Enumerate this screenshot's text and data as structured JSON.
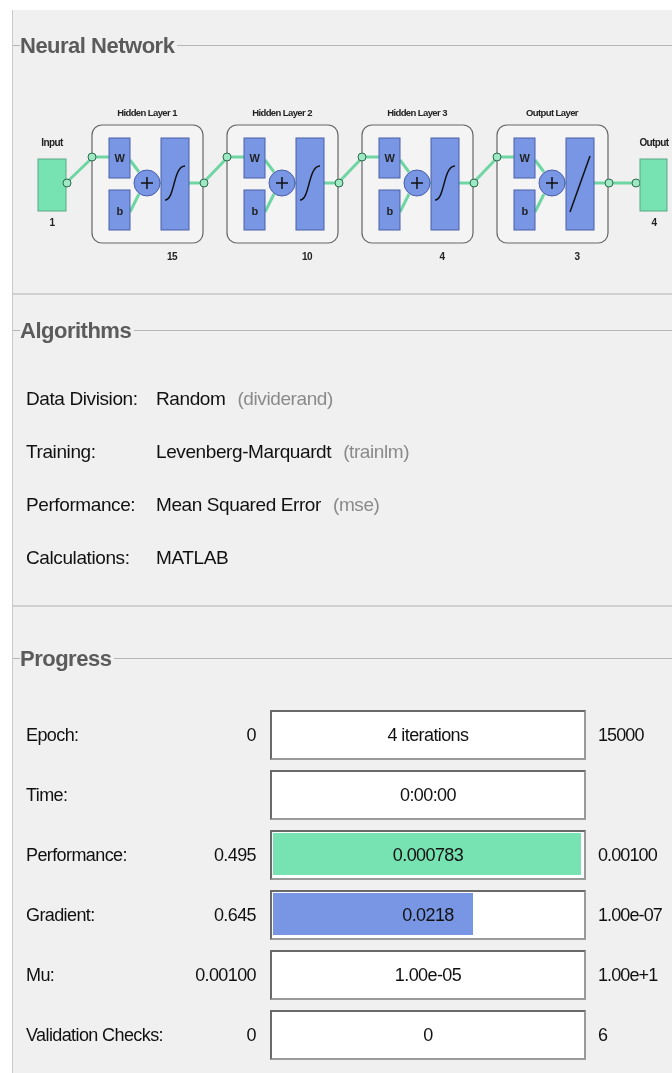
{
  "neural_network": {
    "title": "Neural Network",
    "input": {
      "label": "Input",
      "size": "1"
    },
    "layers": [
      {
        "title": "Hidden Layer 1",
        "size": "15",
        "weight_label": "W",
        "bias_label": "b",
        "kind": "sigmoid"
      },
      {
        "title": "Hidden Layer 2",
        "size": "10",
        "weight_label": "W",
        "bias_label": "b",
        "kind": "sigmoid"
      },
      {
        "title": "Hidden Layer 3",
        "size": "4",
        "weight_label": "W",
        "bias_label": "b",
        "kind": "sigmoid"
      },
      {
        "title": "Output Layer",
        "size": "3",
        "weight_label": "W",
        "bias_label": "b",
        "kind": "linear"
      }
    ],
    "output": {
      "label": "Output",
      "size": "4"
    }
  },
  "algorithms": {
    "title": "Algorithms",
    "rows": [
      {
        "label": "Data Division:",
        "value": "Random",
        "function": "(dividerand)"
      },
      {
        "label": "Training:",
        "value": "Levenberg-Marquardt",
        "function": "(trainlm)"
      },
      {
        "label": "Performance:",
        "value": "Mean Squared Error",
        "function": "(mse)"
      },
      {
        "label": "Calculations:",
        "value": "MATLAB"
      }
    ]
  },
  "progress": {
    "title": "Progress",
    "rows": [
      {
        "label": "Epoch:",
        "start": "0",
        "current": "4 iterations",
        "end": "15000"
      },
      {
        "label": "Time:",
        "current": "0:00:00"
      },
      {
        "label": "Performance:",
        "start": "0.495",
        "current": "0.000783",
        "end": "0.00100",
        "level": 1,
        "color": "#77e2b2"
      },
      {
        "label": "Gradient:",
        "start": "0.645",
        "current": "0.0218",
        "end": "1.00e-07",
        "level": 0.65,
        "color": "#7896e4"
      },
      {
        "label": "Mu:",
        "start": "0.00100",
        "current": "1.00e-05",
        "end": "1.00e+1"
      },
      {
        "label": "Validation Checks:",
        "start": "0",
        "current": "0",
        "end": "6"
      }
    ]
  }
}
